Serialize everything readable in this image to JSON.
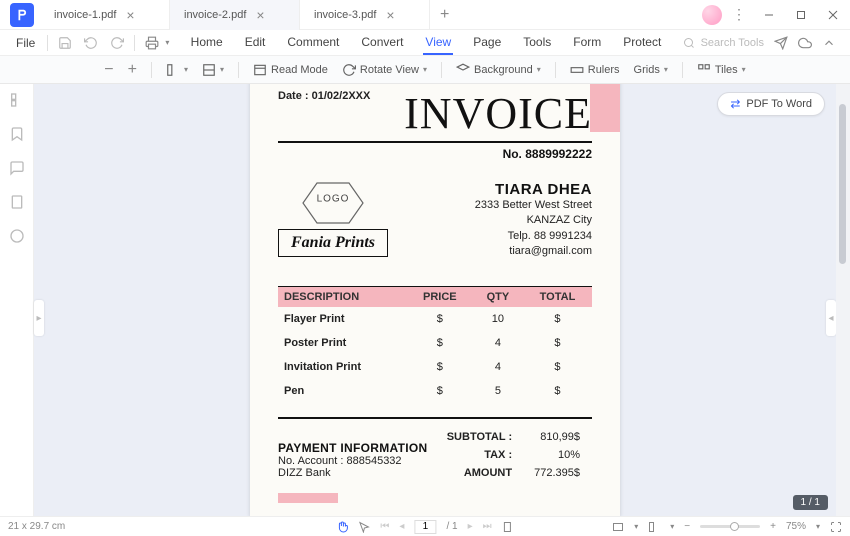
{
  "app": {
    "tabs": [
      "invoice-1.pdf",
      "invoice-2.pdf",
      "invoice-3.pdf"
    ],
    "active_tab": 1
  },
  "menu": {
    "file": "File",
    "items": [
      "Home",
      "Edit",
      "Comment",
      "Convert",
      "View",
      "Page",
      "Tools",
      "Form",
      "Protect"
    ],
    "active": "View",
    "search_placeholder": "Search Tools"
  },
  "toolbar": {
    "read_mode": "Read Mode",
    "rotate": "Rotate View",
    "background": "Background",
    "rulers": "Rulers",
    "grids": "Grids",
    "tiles": "Tiles"
  },
  "pdf2word": "PDF To Word",
  "page_badge": "1 / 1",
  "invoice": {
    "date_label": "Date :",
    "date": "01/02/2XXX",
    "title": "INVOICE",
    "no_label": "No.",
    "no": "8889992222",
    "logo_text": "LOGO",
    "company": "Fania Prints",
    "client": {
      "name": "TIARA DHEA",
      "addr1": "2333 Better West Street",
      "addr2": "KANZAZ City",
      "tel": "Telp. 88 9991234",
      "email": "tiara@gmail.com"
    },
    "columns": [
      "DESCRIPTION",
      "PRICE",
      "QTY",
      "TOTAL"
    ],
    "rows": [
      {
        "desc": "Flayer Print",
        "price": "$",
        "qty": "10",
        "total": "$"
      },
      {
        "desc": "Poster Print",
        "price": "$",
        "qty": "4",
        "total": "$"
      },
      {
        "desc": "Invitation Print",
        "price": "$",
        "qty": "4",
        "total": "$"
      },
      {
        "desc": "Pen",
        "price": "$",
        "qty": "5",
        "total": "$"
      }
    ],
    "totals": {
      "subtotal_l": "SUBTOTAL :",
      "subtotal": "810,99$",
      "tax_l": "TAX :",
      "tax": "10%",
      "amount_l": "AMOUNT",
      "amount": "772.395$"
    },
    "payment": {
      "title": "PAYMENT INFORMATION",
      "acct": "No. Account : 888545332",
      "bank": "DIZZ Bank"
    }
  },
  "status": {
    "dim": "21 x 29.7 cm",
    "page_cur": "1",
    "page_total": "/ 1",
    "zoom": "75%"
  }
}
